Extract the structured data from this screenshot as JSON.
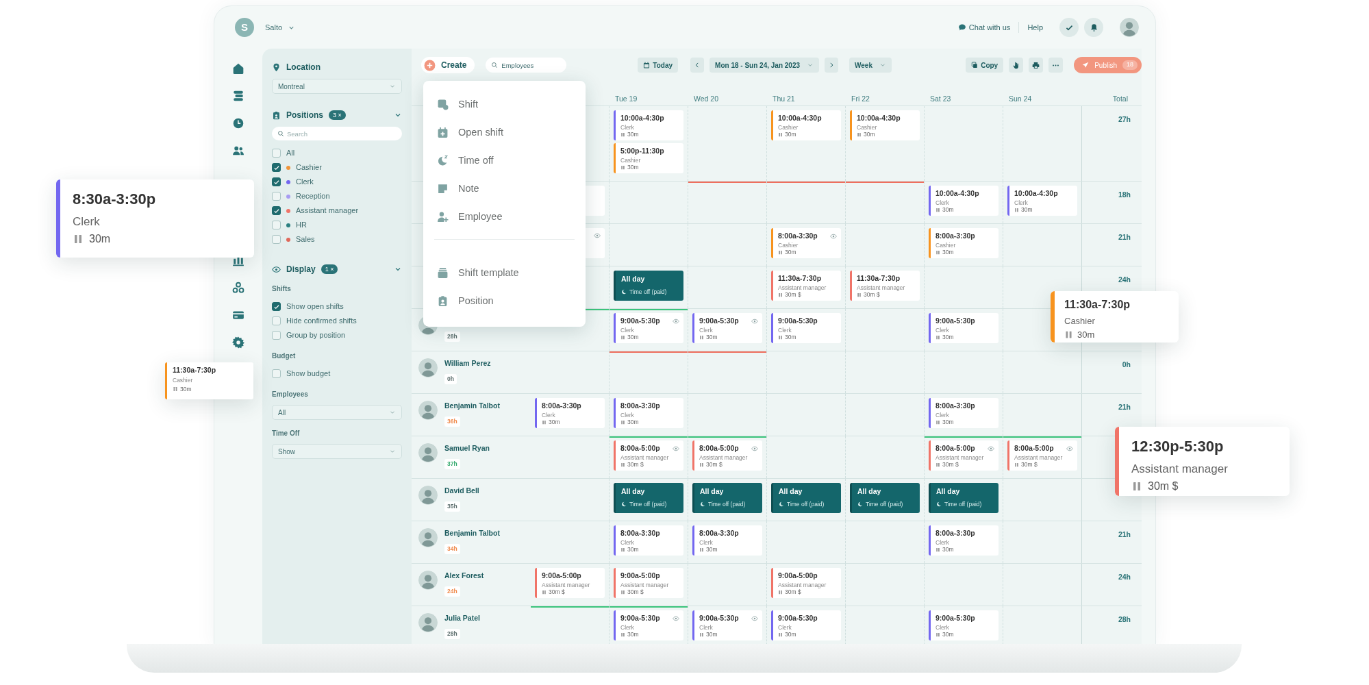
{
  "topbar": {
    "logo_letter": "S",
    "app_name": "Salto",
    "links": [
      {
        "label": "Chat with us",
        "kind": "chat"
      },
      {
        "label": "Help",
        "kind": "help"
      }
    ]
  },
  "toolbar": {
    "create": "Create",
    "search_placeholder": "Employees",
    "today": "Today",
    "date_range": "Mon 18 - Sun 24, Jan 2023",
    "view": "Week",
    "copy": "Copy",
    "publish": "Publish",
    "publish_count": "18"
  },
  "filters": {
    "location": {
      "title": "Location",
      "value": "Montreal"
    },
    "positions": {
      "title": "Positions",
      "count": "3",
      "clear": "×",
      "search_placeholder": "Search",
      "items": [
        {
          "label": "All",
          "checked": false
        },
        {
          "label": "Cashier",
          "checked": true,
          "color": "#f0953a"
        },
        {
          "label": "Clerk",
          "checked": true,
          "color": "#7367f0"
        },
        {
          "label": "Reception",
          "checked": false,
          "color": "#a79cf2"
        },
        {
          "label": "Assistant manager",
          "checked": true,
          "color": "#f07468"
        },
        {
          "label": "HR",
          "checked": false,
          "color": "#2a7f80"
        },
        {
          "label": "Sales",
          "checked": false,
          "color": "#e0685a"
        }
      ]
    },
    "display": {
      "title": "Display",
      "count": "1",
      "clear": "×",
      "groups": [
        {
          "title": "Shifts",
          "items": [
            {
              "label": "Show open shifts",
              "checked": true
            },
            {
              "label": "Hide confirmed shifts",
              "checked": false
            },
            {
              "label": "Group by position",
              "checked": false
            }
          ]
        },
        {
          "title": "Budget",
          "items": [
            {
              "label": "Show budget",
              "checked": false
            }
          ]
        }
      ]
    },
    "employees": {
      "title": "Employees",
      "value": "All"
    },
    "time_off": {
      "title": "Time Off",
      "value": "Show"
    }
  },
  "create_menu": {
    "sections": [
      {
        "items": [
          {
            "label": "Shift",
            "kind": "shift"
          },
          {
            "label": "Open shift",
            "kind": "open_shift"
          },
          {
            "label": "Time off",
            "kind": "time_off"
          },
          {
            "label": "Note",
            "kind": "note"
          },
          {
            "label": "Employee",
            "kind": "employee"
          }
        ]
      },
      {
        "items": [
          {
            "label": "Shift template",
            "kind": "template"
          },
          {
            "label": "Position",
            "kind": "position"
          }
        ]
      }
    ]
  },
  "schedule": {
    "columns": [
      "Tue 19",
      "Wed 20",
      "Thu 21",
      "Fri 22",
      "Sat 23",
      "Sun 24",
      "Total"
    ],
    "rows": [
      {
        "days": {
          "tue": {
            "shifts": [
              {
                "kind": "shift",
                "time": "10:00a-4:30p",
                "position": "Clerk",
                "break": "30m",
                "color": "#7367f0",
                "eye": false
              },
              {
                "kind": "shift",
                "time": "5:00p-11:30p",
                "position": "Cashier",
                "break": "30m",
                "color": "#f7931e",
                "eye": false
              }
            ]
          },
          "thu": {
            "shifts": [
              {
                "kind": "shift",
                "time": "10:00a-4:30p",
                "position": "Cashier",
                "break": "30m",
                "color": "#f7931e",
                "eye": false
              }
            ]
          },
          "fri": {
            "shifts": [
              {
                "kind": "shift",
                "time": "10:00a-4:30p",
                "position": "Cashier",
                "break": "30m",
                "color": "#f7931e",
                "eye": false
              }
            ]
          }
        },
        "total": "27h"
      },
      {
        "days": {
          "mon": {
            "shifts": [
              {
                "kind": "shift"
              }
            ]
          },
          "wed": {
            "color": "#ef6f5e"
          },
          "thu": {
            "color": "#ef6f5e"
          },
          "fri": {
            "color": "#ef6f5e"
          },
          "sat": {
            "shifts": [
              {
                "kind": "shift",
                "time": "10:00a-4:30p",
                "position": "Clerk",
                "break": "30m",
                "color": "#7367f0",
                "eye": false
              }
            ]
          },
          "sun": {
            "shifts": [
              {
                "kind": "shift",
                "time": "10:00a-4:30p",
                "position": "Clerk",
                "break": "30m",
                "color": "#7367f0",
                "eye": false
              }
            ]
          }
        },
        "total": "18h"
      },
      {
        "days": {
          "mon": {
            "shifts": [
              {
                "kind": "shift",
                "eye": true
              }
            ]
          },
          "thu": {
            "shifts": [
              {
                "kind": "shift",
                "time": "8:00a-3:30p",
                "position": "Cashier",
                "break": "30m",
                "color": "#f7931e",
                "eye": true
              }
            ]
          },
          "sat": {
            "shifts": [
              {
                "kind": "shift",
                "time": "8:00a-3:30p",
                "position": "Cashier",
                "break": "30m",
                "color": "#f7931e",
                "eye": false
              }
            ]
          }
        },
        "total": "21h"
      },
      {
        "days": {
          "tue": {
            "shifts": [
              {
                "kind": "time_off",
                "time": "All day",
                "label": "Time off (paid)",
                "eye": false
              }
            ]
          },
          "thu": {
            "shifts": [
              {
                "kind": "shift",
                "time": "11:30a-7:30p",
                "position": "Assistant manager",
                "break": "30m $",
                "color": "#f07468",
                "eye": false
              }
            ]
          },
          "fri": {
            "shifts": [
              {
                "kind": "shift",
                "time": "11:30a-7:30p",
                "position": "Assistant manager",
                "break": "30m $",
                "color": "#f07468",
                "eye": false
              }
            ]
          }
        },
        "total": "24h"
      },
      {
        "employee": {
          "hours": {
            "text": "28h",
            "color": "#5d6f6e"
          }
        },
        "days": {
          "mon": {
            "color": "#3cc47c"
          },
          "tue": {
            "color": "#3cc47c",
            "shifts": [
              {
                "kind": "shift",
                "time": "9:00a-5:30p",
                "position": "Clerk",
                "break": "30m",
                "color": "#7367f0",
                "eye": true
              }
            ]
          },
          "wed": {
            "shifts": [
              {
                "kind": "shift",
                "time": "9:00a-5:30p",
                "position": "Clerk",
                "break": "30m",
                "color": "#7367f0",
                "eye": true
              }
            ]
          },
          "thu": {
            "shifts": [
              {
                "kind": "shift",
                "time": "9:00a-5:30p",
                "position": "Clerk",
                "break": "30m",
                "color": "#7367f0",
                "eye": false
              }
            ]
          },
          "sat": {
            "shifts": [
              {
                "kind": "shift",
                "time": "9:00a-5:30p",
                "position": "Clerk",
                "break": "30m",
                "color": "#7367f0",
                "eye": false
              }
            ]
          }
        }
      },
      {
        "employee": {
          "name": "William Perez",
          "hours": {
            "text": "0h",
            "color": "#5d6f6e"
          }
        },
        "days": {
          "tue": {
            "color": "#ef6f5e"
          },
          "wed": {
            "color": "#ef6f5e"
          }
        },
        "total": "0h"
      },
      {
        "employee": {
          "name": "Benjamin Talbot",
          "hours": {
            "text": "36h",
            "color": "#f0894a"
          }
        },
        "days": {
          "mon": {
            "shifts": [
              {
                "kind": "shift",
                "time": "8:00a-3:30p",
                "position": "Clerk",
                "break": "30m",
                "color": "#7367f0",
                "eye": false
              }
            ]
          },
          "tue": {
            "shifts": [
              {
                "kind": "shift",
                "time": "8:00a-3:30p",
                "position": "Clerk",
                "break": "30m",
                "color": "#7367f0",
                "eye": false
              }
            ]
          },
          "sat": {
            "shifts": [
              {
                "kind": "shift",
                "time": "8:00a-3:30p",
                "position": "Clerk",
                "break": "30m",
                "color": "#7367f0",
                "eye": false
              }
            ]
          }
        },
        "total": "21h"
      },
      {
        "employee": {
          "name": "Samuel Ryan",
          "hours": {
            "text": "37h",
            "color": "#2fa86a"
          }
        },
        "days": {
          "tue": {
            "color": "#3cc47c",
            "shifts": [
              {
                "kind": "shift",
                "time": "8:00a-5:00p",
                "position": "Assistant manager",
                "break": "30m $",
                "color": "#f07468",
                "eye": true
              }
            ]
          },
          "wed": {
            "color": "#3cc47c",
            "shifts": [
              {
                "kind": "shift",
                "time": "8:00a-5:00p",
                "position": "Assistant manager",
                "break": "30m $",
                "color": "#f07468",
                "eye": true
              }
            ]
          },
          "sat": {
            "color": "#3cc47c",
            "shifts": [
              {
                "kind": "shift",
                "time": "8:00a-5:00p",
                "position": "Assistant manager",
                "break": "30m $",
                "color": "#f07468",
                "eye": true
              }
            ]
          },
          "sun": {
            "color": "#3cc47c",
            "shifts": [
              {
                "kind": "shift",
                "time": "8:00a-5:00p",
                "position": "Assistant manager",
                "break": "30m $",
                "color": "#f07468",
                "eye": true
              }
            ]
          }
        }
      },
      {
        "employee": {
          "name": "David Bell",
          "hours": {
            "text": "35h",
            "color": "#5d6f6e"
          }
        },
        "days": {
          "tue": {
            "shifts": [
              {
                "kind": "time_off",
                "time": "All day",
                "label": "Time off (paid)",
                "eye": false
              }
            ]
          },
          "wed": {
            "shifts": [
              {
                "kind": "time_off",
                "time": "All day",
                "label": "Time off (paid)",
                "eye": false
              }
            ]
          },
          "thu": {
            "shifts": [
              {
                "kind": "time_off",
                "time": "All day",
                "label": "Time off (paid)",
                "eye": false
              }
            ]
          },
          "fri": {
            "shifts": [
              {
                "kind": "time_off",
                "time": "All day",
                "label": "Time off (paid)",
                "eye": false
              }
            ]
          },
          "sat": {
            "shifts": [
              {
                "kind": "time_off",
                "time": "All day",
                "label": "Time off (paid)",
                "eye": false
              }
            ]
          }
        }
      },
      {
        "employee": {
          "name": "Benjamin Talbot",
          "hours": {
            "text": "34h",
            "color": "#f0894a"
          }
        },
        "days": {
          "tue": {
            "shifts": [
              {
                "kind": "shift",
                "time": "8:00a-3:30p",
                "position": "Clerk",
                "break": "30m",
                "color": "#7367f0",
                "eye": false
              }
            ]
          },
          "wed": {
            "shifts": [
              {
                "kind": "shift",
                "time": "8:00a-3:30p",
                "position": "Clerk",
                "break": "30m",
                "color": "#7367f0",
                "eye": false
              }
            ]
          },
          "sat": {
            "shifts": [
              {
                "kind": "shift",
                "time": "8:00a-3:30p",
                "position": "Clerk",
                "break": "30m",
                "color": "#7367f0",
                "eye": false
              }
            ]
          }
        },
        "total": "21h"
      },
      {
        "employee": {
          "name": "Alex Forest",
          "hours": {
            "text": "24h",
            "color": "#f0894a"
          }
        },
        "days": {
          "mon": {
            "shifts": [
              {
                "kind": "shift",
                "time": "9:00a-5:00p",
                "position": "Assistant manager",
                "break": "30m $",
                "color": "#f07468",
                "eye": false
              }
            ]
          },
          "tue": {
            "shifts": [
              {
                "kind": "shift",
                "time": "9:00a-5:00p",
                "position": "Assistant manager",
                "break": "30m $",
                "color": "#f07468",
                "eye": false
              }
            ]
          },
          "thu": {
            "shifts": [
              {
                "kind": "shift",
                "time": "9:00a-5:00p",
                "position": "Assistant manager",
                "break": "30m $",
                "color": "#f07468",
                "eye": false
              }
            ]
          }
        },
        "total": "24h"
      },
      {
        "employee": {
          "name": "Julia Patel",
          "hours": {
            "text": "28h",
            "color": "#5d6f6e"
          }
        },
        "days": {
          "mon": {
            "color": "#3cc47c"
          },
          "tue": {
            "color": "#3cc47c",
            "shifts": [
              {
                "kind": "shift",
                "time": "9:00a-5:30p",
                "position": "Clerk",
                "break": "30m",
                "color": "#7367f0",
                "eye": true
              }
            ]
          },
          "wed": {
            "shifts": [
              {
                "kind": "shift",
                "time": "9:00a-5:30p",
                "position": "Clerk",
                "break": "30m",
                "color": "#7367f0",
                "eye": true
              }
            ]
          },
          "thu": {
            "shifts": [
              {
                "kind": "shift",
                "time": "9:00a-5:30p",
                "position": "Clerk",
                "break": "30m",
                "color": "#7367f0",
                "eye": false
              }
            ]
          },
          "sat": {
            "shifts": [
              {
                "kind": "shift",
                "time": "9:00a-5:30p",
                "position": "Clerk",
                "break": "30m",
                "color": "#7367f0",
                "eye": false
              }
            ]
          }
        },
        "total": "28h"
      }
    ]
  },
  "floating_cards": [
    {
      "kind": "large",
      "time": "8:30a-3:30p",
      "position": "Clerk",
      "break": "30m",
      "color": "#7367f0"
    },
    {
      "kind": "small",
      "time": "11:30a-7:30p",
      "position": "Cashier",
      "break": "30m",
      "color": "#f7931e"
    },
    {
      "kind": "medium",
      "time": "11:30a-7:30p",
      "position": "Cashier",
      "break": "30m",
      "color": "#f7931e"
    },
    {
      "kind": "large",
      "time": "12:30p-5:30p",
      "position": "Assistant manager",
      "break": "30m $",
      "color": "#f07468"
    }
  ]
}
